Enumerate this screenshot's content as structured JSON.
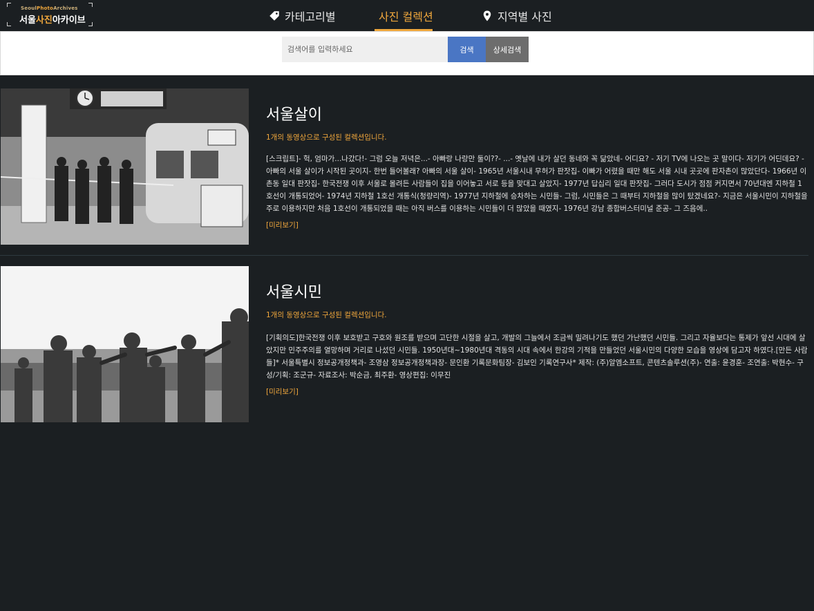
{
  "brand": {
    "sub_prefix": "Seoul",
    "sub_accent": "Photo",
    "sub_suffix": "Archives",
    "name_prefix": "서울",
    "name_accent": "사진",
    "name_suffix": "아카이브"
  },
  "nav": {
    "items": [
      {
        "label": "카테고리별",
        "icon": "tag-icon"
      },
      {
        "label": "사진 컬렉션",
        "icon": "books-icon",
        "active": true
      },
      {
        "label": "지역별 사진",
        "icon": "map-pin-icon"
      }
    ]
  },
  "search": {
    "placeholder": "검색어를 입력하세요",
    "value": "",
    "search_label": "검색",
    "advanced_label": "상세검색"
  },
  "collections": [
    {
      "title": "서울살이",
      "count": "1개의 동영상으로 구성된 컬렉션입니다.",
      "description": "[스크립트]- 헉, 엄마가...나갔다!- 그럼 오늘 저녁은...- 아빠랑 나랑만 둘이??- ...- 옛날에 내가 살던 동네와 꼭 닮았네- 어디요? - 저기 TV에 나오는 곳 말이다- 저기가 어딘데요? - 아빠의 서울 살이가 시작된 곳이지- 한번 들어볼래? 아빠의 서울 살이- 1965년 서울시내 무허가 판잣집- 이빠가 어렸을 때만 해도 서울 시내 곳곳에 판자촌이 많았단다- 1966년 이촌동 일대 판잣집- 한국전쟁 이후 서울로 몰려든 사람들이 집을 이어놓고 서로 등을 맞대고 살았지- 1977년 답십리 일대 판잣집- 그러다 도시가 점점 커지면서 70년대엔 지하철 1호선이 개통되었어- 1974년 지하철 1호선 개통식(청량리역)- 1977년 지하철에 승차하는 시민들- 그럼, 시민들은 그 때부터 지하철을 많이 탔겠네요?- 지금은 서울시민이 지하철을 주로 이용하지만 처음 1호선이 개통되었을 때는 아직 버스를 이용하는 시민들이 더 많았을 때였지- 1976년 강남 종합버스터미널 준공- 그 즈음에..",
      "more": "[미리보기]",
      "photo": "subway-opening-ceremony-photo"
    },
    {
      "title": "서울시민",
      "count": "1개의 동영상으로 구성된 컬렉션입니다.",
      "description": "[기획의도]한국전쟁 이후 보호받고 구호와 원조를 받으며 고단한 시절을 살고, 개발의 그늘에서 조금씩 밀려나기도 했던 가난했던 시민들. 그리고 자율보다는 통제가 앞선 시대에 살았지만 민주주의를 열망하며 거리로 나섰던 시민들. 1950년대~1980년대 격동의 시대 속에서 한강의 기적을 만들었던 서울시민의 다양한 모습을 영상에 담고자 하였다.[만든 사람들]* 서울특별시 정보공개정책과- 조영삼 정보공개정책과장- 문인환 기록문화팀장- 김보인 기록연구사* 제작: (주)알엠소프트, 콘텐츠솔루션(주)- 연출: 윤경훈- 조연출: 박현수- 구성/기획: 조군규- 자료조사: 박순금, 최주환- 영상편집: 이무진",
      "more": "[미리보기]",
      "photo": "citizens-exercise-photo"
    }
  ],
  "colors": {
    "background": "#1b1f22",
    "accent": "#f0a73c",
    "search_button": "#4a76c4",
    "advanced_button": "#6d6d6d"
  }
}
